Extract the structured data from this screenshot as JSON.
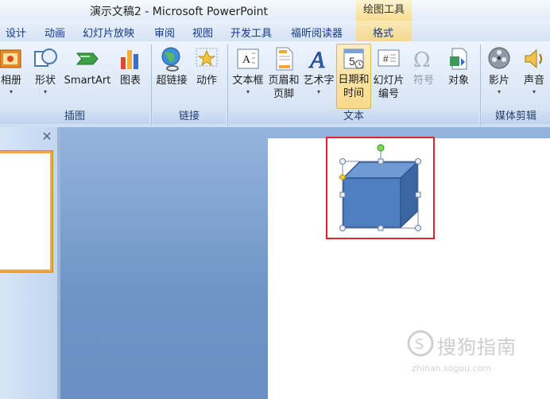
{
  "window": {
    "title": "演示文稿2 - Microsoft PowerPoint",
    "context_tab_title": "绘图工具"
  },
  "tabs": [
    {
      "label": "设计"
    },
    {
      "label": "动画"
    },
    {
      "label": "幻灯片放映"
    },
    {
      "label": "审阅"
    },
    {
      "label": "视图"
    },
    {
      "label": "开发工具"
    },
    {
      "label": "福昕阅读器"
    },
    {
      "label": "格式"
    }
  ],
  "ribbon": {
    "groups": {
      "illustrations": {
        "label": "插图",
        "buttons": [
          {
            "label": "相册",
            "icon": "photo-album-icon"
          },
          {
            "label": "形状",
            "icon": "shapes-icon"
          },
          {
            "label": "SmartArt",
            "icon": "smartart-icon"
          },
          {
            "label": "图表",
            "icon": "chart-icon"
          }
        ]
      },
      "links": {
        "label": "链接",
        "buttons": [
          {
            "label": "超链接",
            "icon": "hyperlink-globe-icon"
          },
          {
            "label": "动作",
            "icon": "action-star-icon"
          }
        ]
      },
      "text": {
        "label": "文本",
        "buttons": [
          {
            "label": "文本框",
            "icon": "textbox-icon"
          },
          {
            "label": "页眉和",
            "label2": "页脚",
            "icon": "header-footer-icon"
          },
          {
            "label": "艺术字",
            "icon": "wordart-icon"
          },
          {
            "label": "日期和",
            "label2": "时间",
            "icon": "date-time-icon"
          },
          {
            "label": "幻灯片",
            "label2": "编号",
            "icon": "slide-number-icon"
          },
          {
            "label": "符号",
            "icon": "omega-symbol-icon"
          },
          {
            "label": "对象",
            "icon": "object-icon"
          }
        ]
      },
      "media": {
        "label": "媒体剪辑",
        "buttons": [
          {
            "label": "影片",
            "icon": "film-reel-icon"
          },
          {
            "label": "声音",
            "icon": "speaker-icon"
          }
        ]
      }
    }
  },
  "left_pane": {
    "close_symbol": "✕"
  },
  "watermark": {
    "text": "搜狗指南",
    "sub": "zhinan.sogou.com"
  },
  "colors": {
    "cube_front": "#4e7fc1",
    "cube_top": "#6f9ad4",
    "cube_side": "#3c66a3",
    "highlight": "#e0242a",
    "selected_button": "#f9d98a"
  }
}
